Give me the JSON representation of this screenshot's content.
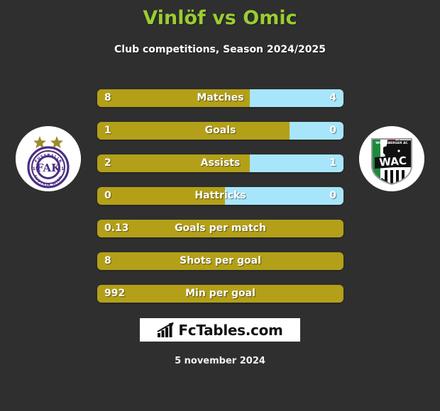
{
  "header": {
    "title": "Vinlöf vs Omic",
    "subtitle": "Club competitions, Season 2024/2025",
    "title_color": "#9acd32"
  },
  "teams": {
    "home": {
      "logo_name": "austria-wien-crest",
      "alt": "FK Austria Wien",
      "primary_color": "#b3a018"
    },
    "away": {
      "logo_name": "wolfsberger-ac-crest",
      "alt": "Wolfsberger AC",
      "primary_color": "#a7e6fa"
    }
  },
  "stats": [
    {
      "label": "Matches",
      "left": "8",
      "right": "4",
      "left_pct": 62,
      "type": "compare"
    },
    {
      "label": "Goals",
      "left": "1",
      "right": "0",
      "left_pct": 78,
      "type": "compare"
    },
    {
      "label": "Assists",
      "left": "2",
      "right": "1",
      "left_pct": 62,
      "type": "compare"
    },
    {
      "label": "Hattricks",
      "left": "0",
      "right": "0",
      "left_pct": 52,
      "type": "compare"
    },
    {
      "label": "Goals per match",
      "left": "0.13",
      "right": "",
      "left_pct": 100,
      "type": "single"
    },
    {
      "label": "Shots per goal",
      "left": "8",
      "right": "",
      "left_pct": 100,
      "type": "single"
    },
    {
      "label": "Min per goal",
      "left": "992",
      "right": "",
      "left_pct": 100,
      "type": "single"
    }
  ],
  "footer": {
    "brand": "FcTables.com",
    "brand_icon": "bar-chart-arrow-icon",
    "date": "5 november 2024"
  }
}
